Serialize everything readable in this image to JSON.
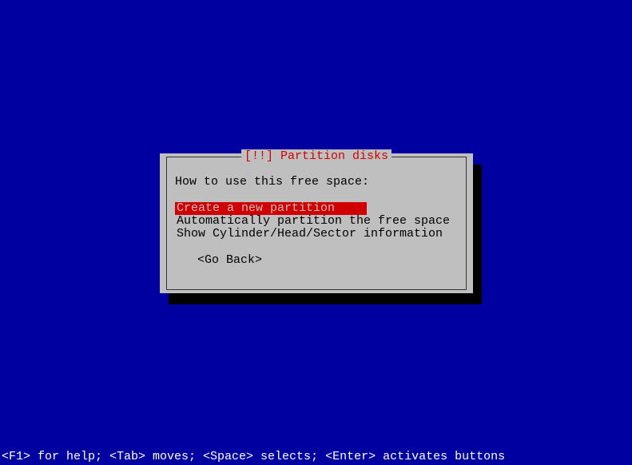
{
  "dialog": {
    "title": "[!!] Partition disks",
    "prompt": "How to use this free space:",
    "options": [
      {
        "label": "Create a new partition",
        "selected": true
      },
      {
        "label": "Automatically partition the free space",
        "selected": false
      },
      {
        "label": "Show Cylinder/Head/Sector information",
        "selected": false
      }
    ],
    "go_back_label": "<Go Back>"
  },
  "status_bar": "<F1> for help; <Tab> moves; <Space> selects; <Enter> activates buttons"
}
